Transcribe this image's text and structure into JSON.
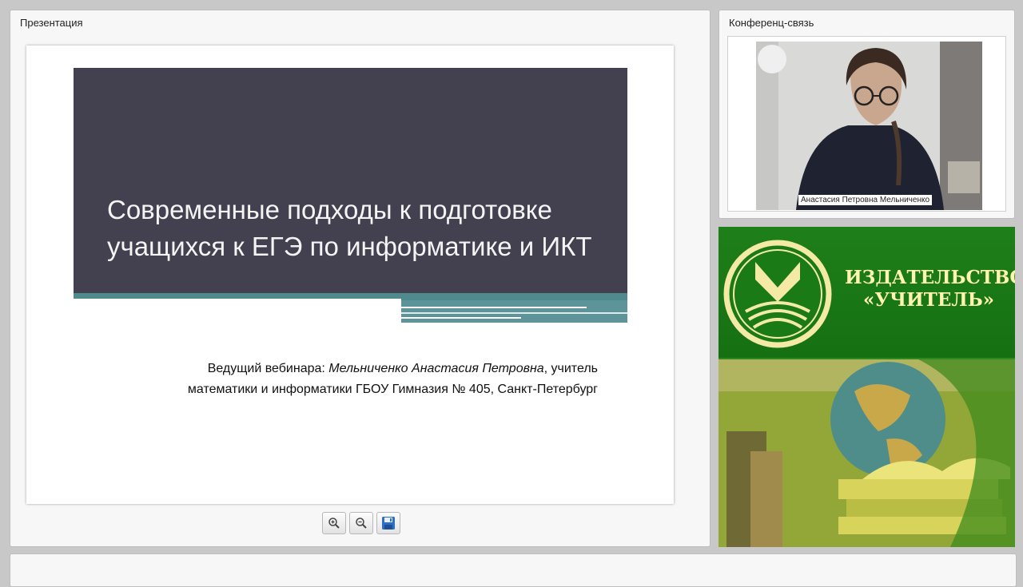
{
  "presentation": {
    "panel_title": "Презентация",
    "slide": {
      "title": "Современные подходы к подготовке учащихся к ЕГЭ по информатике и ИКТ",
      "presenter_prefix": "Ведущий вебинара: ",
      "presenter_name": "Мельниченко Анастасия Петровна",
      "presenter_suffix": ", учитель",
      "presenter_line2": "математики и информатики ГБОУ Гимназия № 405, Санкт-Петербург"
    },
    "toolbar": {
      "zoom_in_icon": "zoom-in-icon",
      "zoom_out_icon": "zoom-out-icon",
      "save_icon": "save-icon"
    }
  },
  "conference": {
    "panel_title": "Конференц-связь",
    "participant_name": "Анастасия Петровна Мельниченко"
  },
  "ad": {
    "publisher_line1": "ИЗДАТЕЛЬСТВО",
    "publisher_line2": "«УЧИТЕЛЬ»",
    "colors": {
      "green": "#1f7f19",
      "gold": "#fff3b0"
    }
  }
}
